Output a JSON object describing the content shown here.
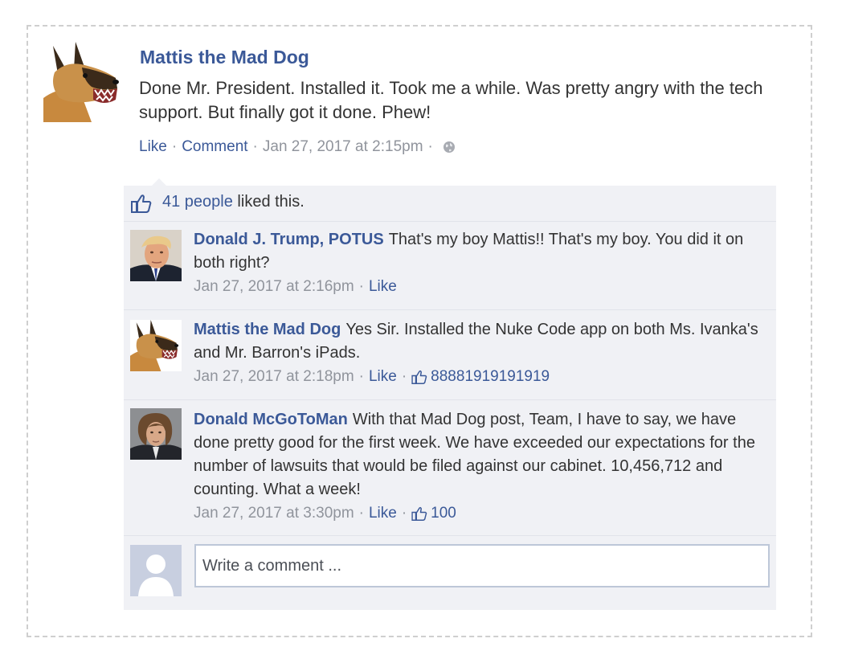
{
  "post": {
    "author": "Mattis the Mad Dog",
    "text": "Done Mr. President. Installed it. Took me a while. Was pretty angry with the tech support. But finally got it done. Phew!",
    "like_label": "Like",
    "comment_label": "Comment",
    "timestamp": "Jan 27, 2017 at 2:15pm",
    "separator": "·"
  },
  "likes": {
    "count_text": "41 people",
    "suffix": " liked this."
  },
  "comments": [
    {
      "author": "Donald J. Trump, POTUS",
      "text": "That's my boy Mattis!! That's my boy. You did it on both right?",
      "timestamp": "Jan 27, 2017 at 2:16pm",
      "like_label": "Like",
      "avatar": "trump-avatar"
    },
    {
      "author": "Mattis the Mad Dog",
      "text": "Yes Sir. Installed the Nuke Code app on both Ms. Ivanka's and Mr. Barron's iPads.",
      "timestamp": "Jan 27, 2017 at 2:18pm",
      "like_label": "Like",
      "like_count": "88881919191919",
      "avatar": "dog-avatar"
    },
    {
      "author": "Donald McGoToMan",
      "text": "With that Mad Dog post, Team, I have to say, we have done pretty good for the first week. We have exceeded our expectations for the number of lawsuits that would be filed against our cabinet. 10,456,712 and counting. What a week!",
      "timestamp": "Jan 27, 2017 at 3:30pm",
      "like_label": "Like",
      "like_count": "100",
      "avatar": "mcgahn-avatar"
    }
  ],
  "reply": {
    "placeholder": "Write a comment ..."
  },
  "colors": {
    "link": "#3b5998",
    "meta": "#90949c",
    "panel": "#f0f1f5"
  }
}
